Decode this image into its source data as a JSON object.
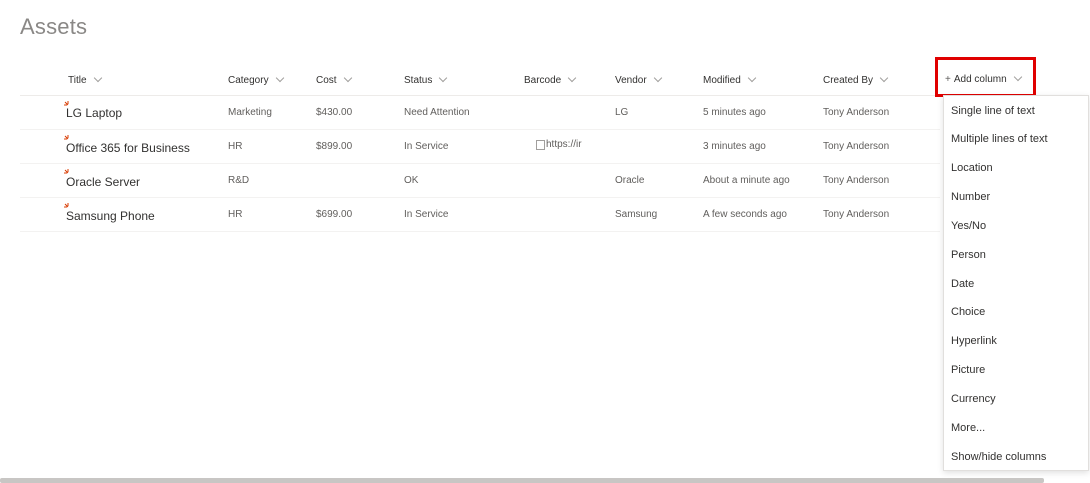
{
  "page": {
    "title": "Assets"
  },
  "columns": [
    {
      "key": "title",
      "label": "Title"
    },
    {
      "key": "category",
      "label": "Category"
    },
    {
      "key": "cost",
      "label": "Cost"
    },
    {
      "key": "status",
      "label": "Status"
    },
    {
      "key": "barcode",
      "label": "Barcode"
    },
    {
      "key": "vendor",
      "label": "Vendor"
    },
    {
      "key": "modified",
      "label": "Modified"
    },
    {
      "key": "created_by",
      "label": "Created By"
    }
  ],
  "add_column": {
    "label": "Add column",
    "icon": "plus-icon"
  },
  "rows": [
    {
      "title": "LG Laptop",
      "category": "Marketing",
      "cost": "$430.00",
      "status": "Need Attention",
      "barcode": "",
      "vendor": "LG",
      "modified": "5 minutes ago",
      "created_by": "Tony Anderson"
    },
    {
      "title": "Office 365 for Business",
      "category": "HR",
      "cost": "$899.00",
      "status": "In Service",
      "barcode": "https://ir",
      "vendor": "",
      "modified": "3 minutes ago",
      "created_by": "Tony Anderson"
    },
    {
      "title": "Oracle Server",
      "category": "R&D",
      "cost": "",
      "status": "OK",
      "barcode": "",
      "vendor": "Oracle",
      "modified": "About a minute ago",
      "created_by": "Tony Anderson"
    },
    {
      "title": "Samsung Phone",
      "category": "HR",
      "cost": "$699.00",
      "status": "In Service",
      "barcode": "",
      "vendor": "Samsung",
      "modified": "A few seconds ago",
      "created_by": "Tony Anderson"
    }
  ],
  "menu": {
    "items": [
      "Single line of text",
      "Multiple lines of text",
      "Location",
      "Number",
      "Yes/No",
      "Person",
      "Date",
      "Choice",
      "Hyperlink",
      "Picture",
      "Currency",
      "More...",
      "Show/hide columns"
    ]
  },
  "colors": {
    "new_marker": "#d83b01",
    "highlight": "#e00000"
  }
}
